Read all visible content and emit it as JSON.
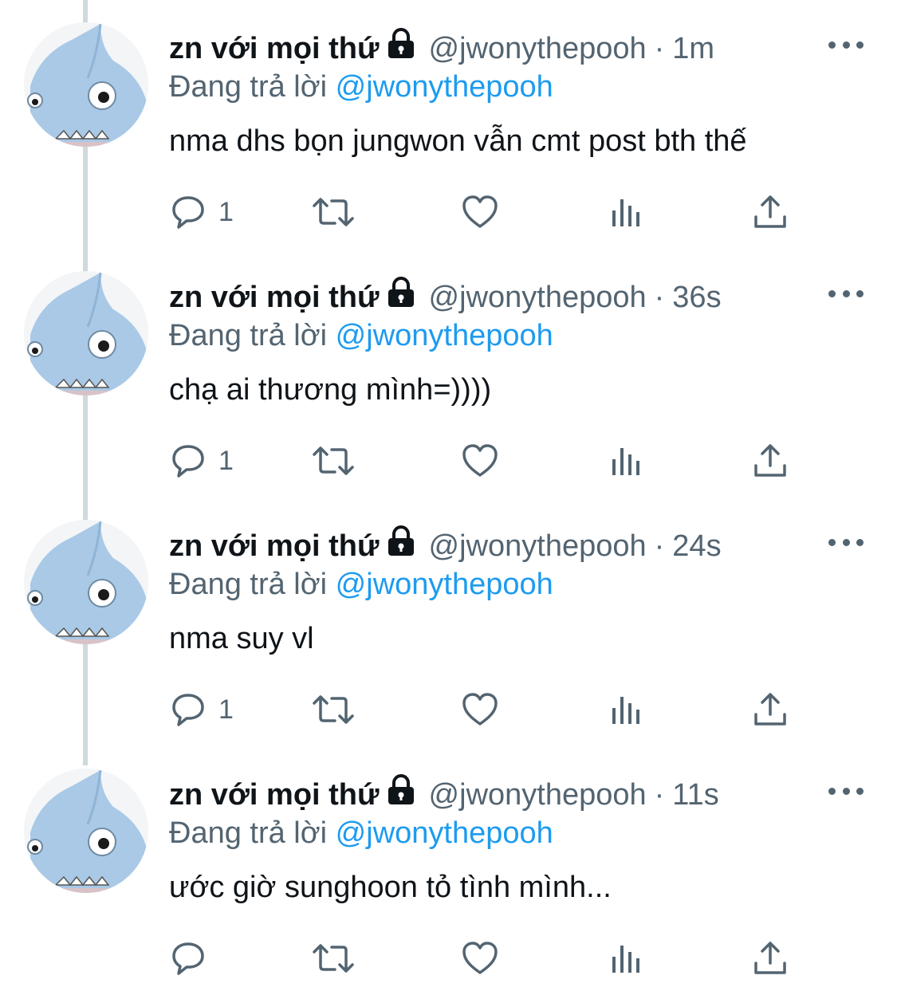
{
  "colors": {
    "text": "#0f1419",
    "secondary": "#536471",
    "accent": "#1d9bf0",
    "thread_line": "#cfd9de",
    "avatar_blue": "#a9c9e6"
  },
  "icons": {
    "lock": "lock-icon",
    "more": "more-icon",
    "reply": "reply-icon",
    "retweet": "retweet-icon",
    "like": "heart-icon",
    "views": "views-icon",
    "share": "share-icon"
  },
  "tweets": [
    {
      "name": "zn với mọi thứ",
      "handle": "@jwonythepooh",
      "dot": "·",
      "time": "1m",
      "reply_prefix": "Đang trả lời",
      "reply_to": "@jwonythepooh",
      "text": "nma dhs bọn jungwon vẫn cmt post bth thế",
      "reply_count": "1"
    },
    {
      "name": "zn với mọi thứ",
      "handle": "@jwonythepooh",
      "dot": "·",
      "time": "36s",
      "reply_prefix": "Đang trả lời",
      "reply_to": "@jwonythepooh",
      "text": "chạ ai thương mình=))))",
      "reply_count": "1"
    },
    {
      "name": "zn với mọi thứ",
      "handle": "@jwonythepooh",
      "dot": "·",
      "time": "24s",
      "reply_prefix": "Đang trả lời",
      "reply_to": "@jwonythepooh",
      "text": "nma suy vl",
      "reply_count": "1"
    },
    {
      "name": "zn với mọi thứ",
      "handle": "@jwonythepooh",
      "dot": "·",
      "time": "11s",
      "reply_prefix": "Đang trả lời",
      "reply_to": "@jwonythepooh",
      "text": "ước giờ sunghoon tỏ tình mình...",
      "reply_count": ""
    }
  ]
}
